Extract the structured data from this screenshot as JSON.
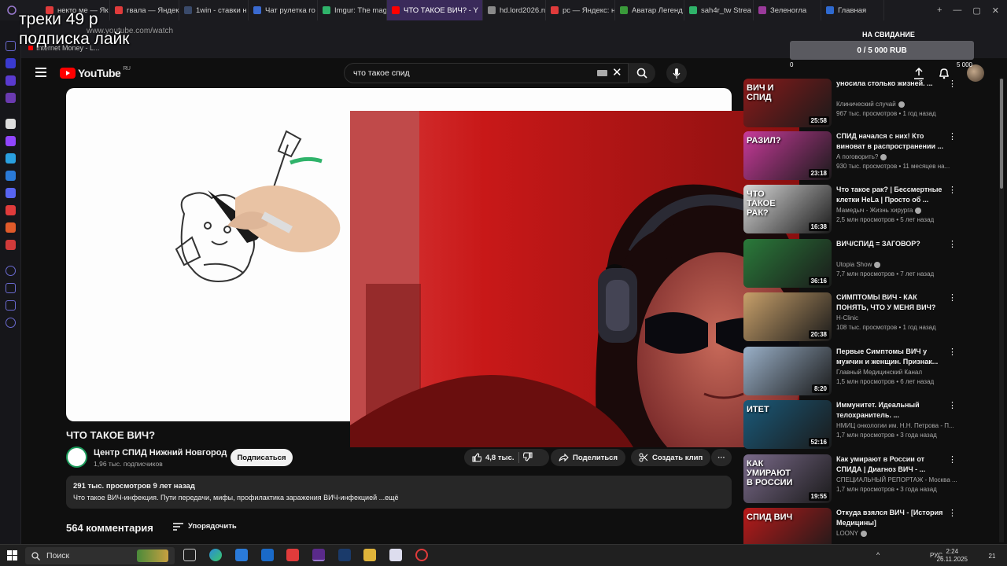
{
  "browser": {
    "tabs": [
      {
        "label": "некто ме — Як",
        "color": "#e03b3b"
      },
      {
        "label": "гвала — Яндек",
        "color": "#e03b3b"
      },
      {
        "label": "1win - ставки н",
        "color": "#3a4a6a"
      },
      {
        "label": "Чат рулетка го",
        "color": "#3a6ad0"
      },
      {
        "label": "Imgur: The mag",
        "color": "#2fb36a"
      },
      {
        "label": "ЧТО ТАКОЕ ВИЧ? - Y",
        "color": "#ff0000"
      },
      {
        "label": "hd.lord2026.ru",
        "color": "#8a8a8a"
      },
      {
        "label": "рс — Яндекс: н",
        "color": "#e03b3b"
      },
      {
        "label": "Аватар Легенд",
        "color": "#3a9a3a"
      },
      {
        "label": "sah4r_tw Strea",
        "color": "#2fb36a"
      },
      {
        "label": "Зеленогла",
        "color": "#9a3a9a"
      },
      {
        "label": "Главная",
        "color": "#2f6ad0"
      }
    ],
    "url": "www.youtube.com/watch",
    "now_playing": "Internet Money - L..."
  },
  "overlay": {
    "line1": "треки 49 р",
    "line2": "подписка лайк",
    "donation_title": "НА СВИДАНИЕ",
    "donation_progress": "0 / 5 000 RUB",
    "donation_min": "0",
    "donation_max": "5 000"
  },
  "youtube": {
    "logo": "YouTube",
    "region": "RU",
    "search_value": "что такое спид"
  },
  "video": {
    "title": "ЧТО ТАКОЕ ВИЧ?",
    "channel": "Центр СПИД Нижний Новгород",
    "subscribers": "1,96 тыс. подписчиков",
    "subscribe_label": "Подписаться",
    "likes": "4,8 тыс.",
    "share_label": "Поделиться",
    "clip_label": "Создать клип",
    "views_date": "291 тыс. просмотров  9 лет назад",
    "description": "Что такое ВИЧ-инфекция. Пути передачи, мифы, профилактика заражения ВИЧ-инфекцией ...ещё",
    "comments_count": "564 комментария",
    "sort_label": "Упорядочить"
  },
  "recommendations": [
    {
      "title": "уносила столько жизней. ...",
      "channel": "Клинический случай",
      "verified": true,
      "views": "967 тыс. просмотров • 1 год назад",
      "duration": "25:58",
      "thumb_color": "#8a1a1a",
      "thumb_text": "ВИЧ И СПИД"
    },
    {
      "title": "СПИД начался с них! Кто виноват в распространении ...",
      "channel": "А поговорить?",
      "verified": true,
      "views": "930 тыс. просмотров • 11 месяцев на...",
      "duration": "23:18",
      "thumb_color": "#c83a9a",
      "thumb_text": "РАЗИЛ?"
    },
    {
      "title": "Что такое рак? | Бессмертные клетки HeLa | Просто об ...",
      "channel": "Мамедыч - Жизнь хирурга",
      "verified": true,
      "views": "2,5 млн просмотров • 5 лет назад",
      "duration": "16:38",
      "thumb_color": "#d8d8d8",
      "thumb_text": "ЧТО ТАКОЕ РАК?"
    },
    {
      "title": "ВИЧ/СПИД = ЗАГОВОР?",
      "channel": "Utopia Show",
      "verified": true,
      "views": "7,7 млн просмотров • 7 лет назад",
      "duration": "36:16",
      "thumb_color": "#2a7a3a",
      "thumb_text": ""
    },
    {
      "title": "СИМПТОМЫ ВИЧ - КАК ПОНЯТЬ, ЧТО У МЕНЯ ВИЧ?",
      "channel": "H-Clinic",
      "verified": false,
      "views": "108 тыс. просмотров • 1 год назад",
      "duration": "20:38",
      "thumb_color": "#c8a06a",
      "thumb_text": ""
    },
    {
      "title": "Первые Симптомы ВИЧ у мужчин и женщин. Признак...",
      "channel": "Главный Медицинский Канал",
      "verified": false,
      "views": "1,5 млн просмотров • 6 лет назад",
      "duration": "8:20",
      "thumb_color": "#9ab0c8",
      "thumb_text": ""
    },
    {
      "title": "Иммунитет. Идеальный телохранитель. ...",
      "channel": "НМИЦ онкологии им. Н.Н. Петрова - П...",
      "verified": false,
      "views": "1,7 млн просмотров • 3 года назад",
      "duration": "52:16",
      "thumb_color": "#1a5a7a",
      "thumb_text": "ИТЕТ"
    },
    {
      "title": "Как умирают в России от СПИДА | Диагноз ВИЧ - ...",
      "channel": "СПЕЦИАЛЬНЫЙ РЕПОРТАЖ - Москва ...",
      "verified": false,
      "views": "1,7 млн просмотров • 3 года назад",
      "duration": "19:55",
      "thumb_color": "#7a6a8a",
      "thumb_text": "КАК УМИРАЮТ В РОССИИ"
    },
    {
      "title": "Откуда взялся ВИЧ - [История Медицины]",
      "channel": "LOONY",
      "verified": true,
      "views": "",
      "duration": "",
      "thumb_color": "#b81a1a",
      "thumb_text": "СПИД ВИЧ"
    }
  ],
  "taskbar": {
    "search_placeholder": "Поиск",
    "lang": "РУС",
    "time": "2:24",
    "date": "26.11.2025",
    "notif": "21"
  }
}
